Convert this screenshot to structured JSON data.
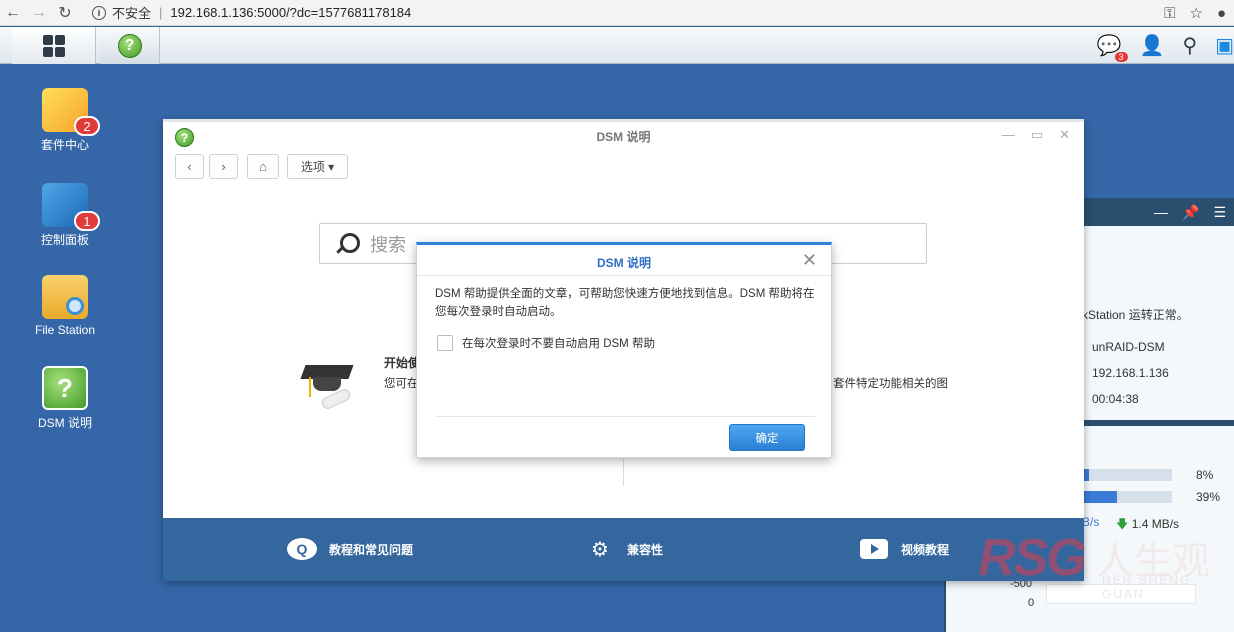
{
  "browser": {
    "security": "不安全",
    "url": "192.168.1.136:5000/?dc=1577681178184"
  },
  "taskbar": {
    "notification_count": "3"
  },
  "desktop": {
    "icons": [
      {
        "label": "套件中心",
        "badge": "2"
      },
      {
        "label": "控制面板",
        "badge": "1"
      },
      {
        "label": "File Station"
      },
      {
        "label": "DSM 说明"
      }
    ]
  },
  "help_window": {
    "title": "DSM 说明",
    "options_label": "选项 ▾",
    "search_placeholder": "搜索",
    "start_heading": "开始使",
    "start_desc": "您可在",
    "right_desc": "套件特定功能相关的图",
    "footer": {
      "faq": "教程和常见问题",
      "compat": "兼容性",
      "video": "视频教程"
    }
  },
  "dialog": {
    "title": "DSM 说明",
    "message": "DSM 帮助提供全面的文章，可帮助您快速方便地找到信息。DSM 帮助将在您每次登录时自动启动。",
    "checkbox_label": "在每次登录时不要自动启用 DSM 帮助",
    "ok_label": "确定"
  },
  "widget": {
    "status_text": "kStation 运转正常。",
    "server_name": "unRAID-DSM",
    "ip": "192.168.1.136",
    "uptime": "00:04:38",
    "cpu_percent": "8%",
    "cpu_fraction": 0.08,
    "ram_percent": "39%",
    "ram_fraction": 0.39,
    "upload_speed": "B/s",
    "download_speed": "1.4 MB/s",
    "graph_axis": [
      "-500",
      "0"
    ]
  },
  "watermark": {
    "logo": "RSG",
    "cn": "人生观",
    "pinyin": "REN SHENG GUAN"
  }
}
